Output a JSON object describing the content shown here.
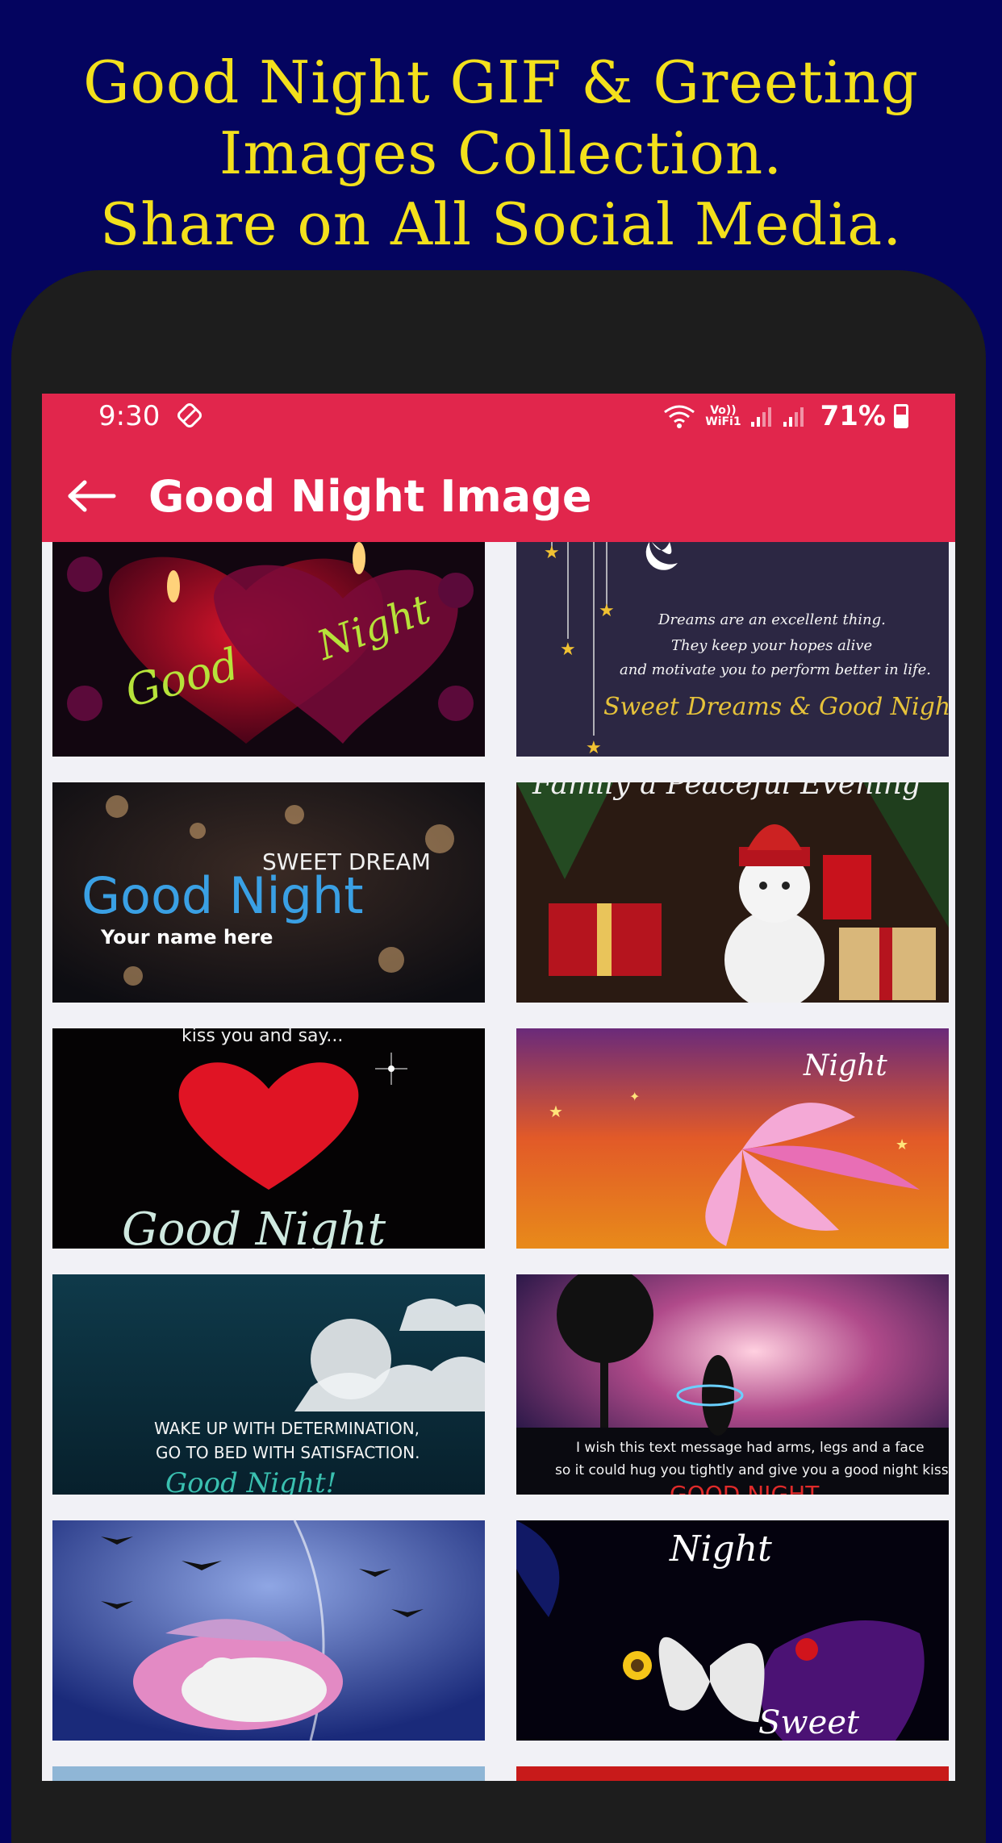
{
  "promo": {
    "line1": "Good Night GIF & Greeting",
    "line2": "Images Collection.",
    "line3": "Share on All Social Media."
  },
  "status_bar": {
    "time": "9:30",
    "network_label_top": "Vo))",
    "network_label_bottom": "WiFi1",
    "battery": "71%"
  },
  "app_bar": {
    "title": "Good Night Image"
  },
  "colors": {
    "brand_red": "#e1264c",
    "promo_background": "#04045f",
    "promo_text": "#f3e01c"
  },
  "tiles": [
    {
      "good": "Good",
      "night": "Night"
    },
    {
      "line1": "Dreams are an excellent thing.",
      "line2": "They keep your hopes alive",
      "line3": "and motivate you to perform better in life.",
      "line4": "Sweet Dreams & Good Night!"
    },
    {
      "top": "SWEET DREAM",
      "main": "Good Night",
      "sub": "Your name here"
    },
    {
      "top": "Family a Peaceful Evening"
    },
    {
      "top": "kiss you and say...",
      "bottom": "Good Night"
    },
    {
      "word": "Night"
    },
    {
      "line1": "WAKE UP WITH DETERMINATION,",
      "line2": "GO TO BED WITH SATISFACTION.",
      "line3": "Good Night!"
    },
    {
      "line1": "I wish this text message had arms, legs and a face",
      "line2": "so it could hug you tightly and give you a good night kiss.",
      "line3": "GOOD NIGHT"
    },
    {},
    {
      "top": "Night",
      "bottom": "Sweet"
    }
  ]
}
